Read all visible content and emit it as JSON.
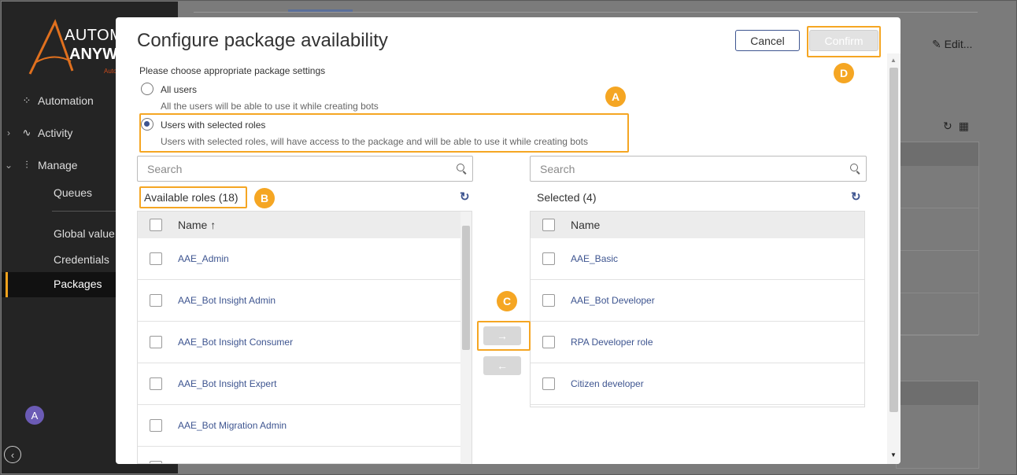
{
  "sidebar": {
    "logo": {
      "line1": "AUTOM",
      "line2": "ANYW",
      "sub": "Auto"
    },
    "nav": [
      {
        "label": "Automation",
        "icon": "automation-icon"
      },
      {
        "label": "Activity",
        "icon": "activity-icon"
      },
      {
        "label": "Manage",
        "icon": "manage-icon"
      }
    ],
    "manage_items": [
      "Queues",
      "Global value",
      "Credentials",
      "Packages"
    ],
    "active_item": "Packages",
    "avatar_initial": "A"
  },
  "background": {
    "edit_label": "Edit..."
  },
  "modal": {
    "title": "Configure package availability",
    "cancel_label": "Cancel",
    "confirm_label": "Confirm",
    "prompt": "Please choose appropriate package settings",
    "options": [
      {
        "label": "All users",
        "description": "All the users will be able to use it while creating bots",
        "selected": false
      },
      {
        "label": "Users with selected roles",
        "description": "Users with selected roles, will have access to the package and will be able to use it while creating bots",
        "selected": true
      }
    ],
    "available": {
      "search_placeholder": "Search",
      "title": "Available roles",
      "count": "(18)",
      "header": "Name ↑",
      "rows": [
        "AAE_Admin",
        "AAE_Bot Insight Admin",
        "AAE_Bot Insight Consumer",
        "AAE_Bot Insight Expert",
        "AAE_Bot Migration Admin"
      ]
    },
    "selected": {
      "search_placeholder": "Search",
      "title": "Selected",
      "count": "(4)",
      "header": "Name",
      "rows": [
        "AAE_Basic",
        "AAE_Bot Developer",
        "RPA Developer role",
        "Citizen developer"
      ]
    },
    "move_right": "→",
    "move_left": "←"
  },
  "callouts": [
    "A",
    "B",
    "C",
    "D"
  ],
  "colors": {
    "accent": "#3e5590",
    "callout": "#f5a623",
    "sidebar": "#242424"
  }
}
